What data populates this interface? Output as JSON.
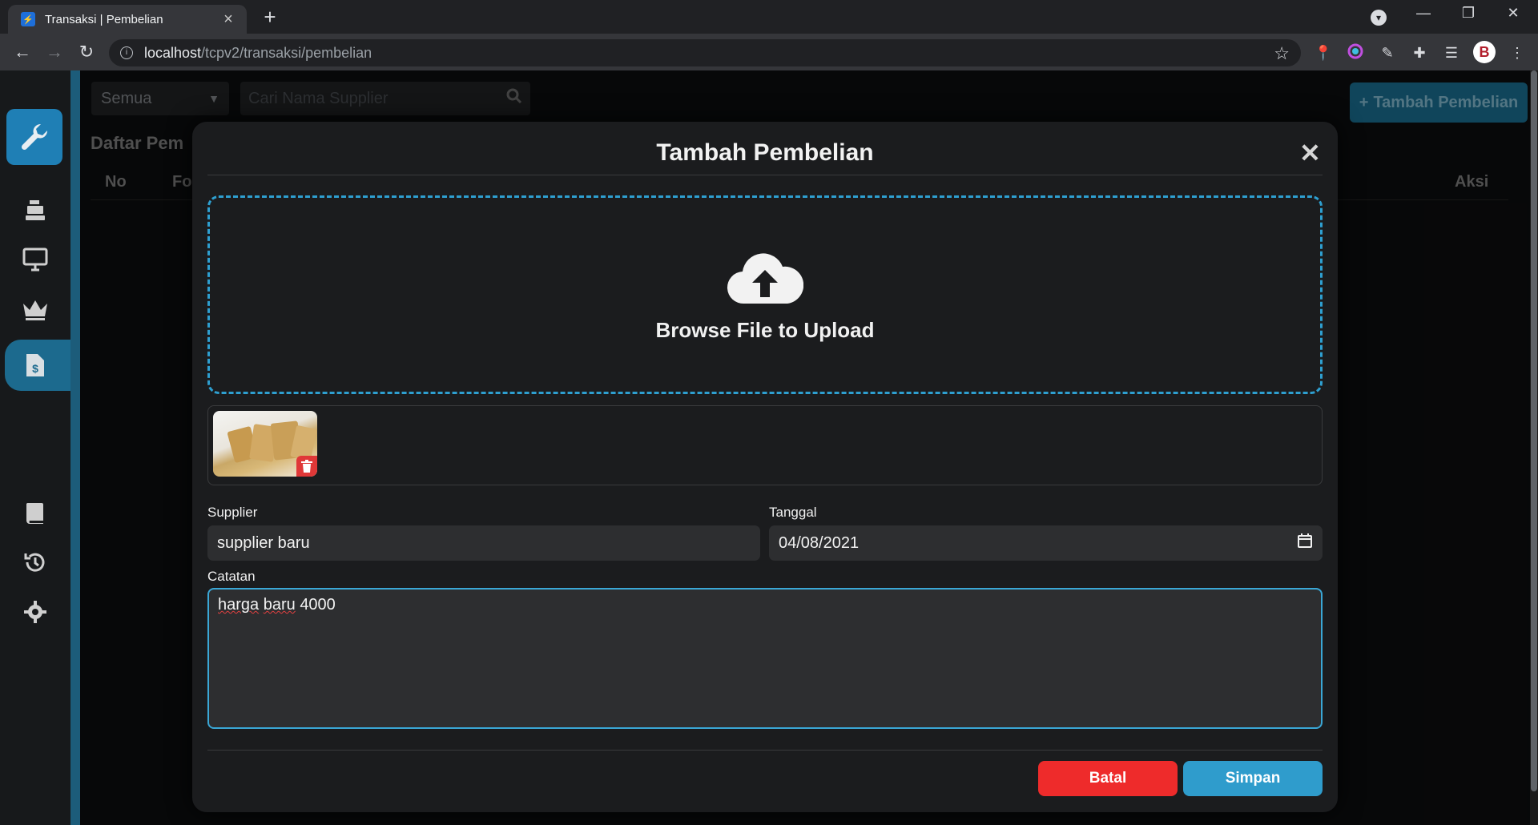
{
  "browser": {
    "tab_title": "Transaksi | Pembelian",
    "url_host": "localhost",
    "url_path": "/tcpv2/transaksi/pembelian"
  },
  "page": {
    "filter": {
      "selected": "Semua"
    },
    "search": {
      "placeholder": "Cari Nama Supplier"
    },
    "add_button": "Tambah Pembelian",
    "list_title": "Daftar Pem",
    "table_headers": {
      "no": "No",
      "fo": "Fo",
      "aksi": "Aksi"
    }
  },
  "sidebar": {
    "icons": [
      "wrench-logo-icon",
      "cash-register-icon",
      "monitor-icon",
      "crown-icon",
      "invoice-icon",
      "book-icon",
      "history-icon",
      "gear-icon"
    ],
    "active": "invoice-icon"
  },
  "modal": {
    "title": "Tambah Pembelian",
    "upload_text": "Browse File to Upload",
    "supplier": {
      "label": "Supplier",
      "value": "supplier baru"
    },
    "tanggal": {
      "label": "Tanggal",
      "value": "04/08/2021"
    },
    "catatan": {
      "label": "Catatan",
      "value_words": [
        "harga",
        "baru",
        "4000"
      ]
    },
    "cancel_label": "Batal",
    "save_label": "Simpan"
  },
  "colors": {
    "accent": "#2f9ccc",
    "danger": "#ee2b2b",
    "sidebar_active": "#1c6a8e"
  }
}
